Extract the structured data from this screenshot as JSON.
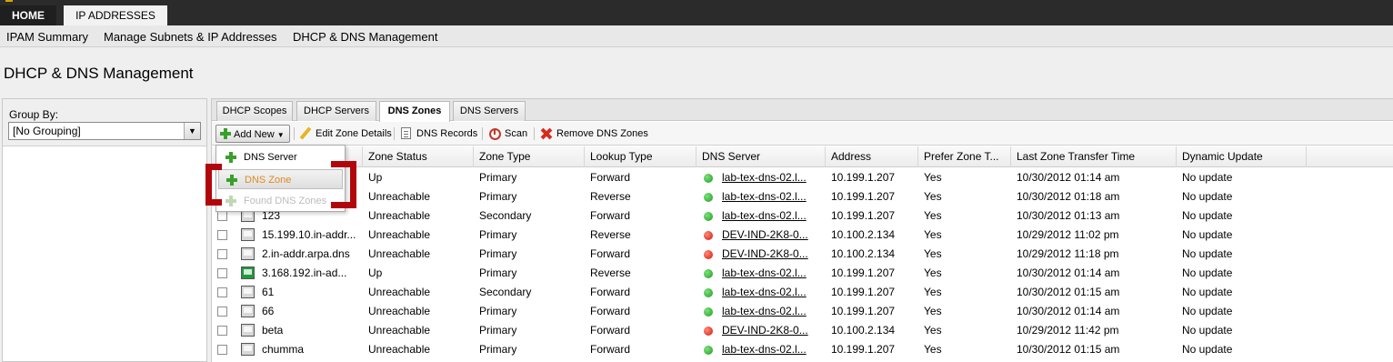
{
  "top_tabs": {
    "home": "HOME",
    "ip": "IP ADDRESSES"
  },
  "subnav": {
    "ipam": "IPAM Summary",
    "subnets": "Manage Subnets & IP Addresses",
    "dhcp_dns": "DHCP & DNS Management"
  },
  "page_title": "DHCP & DNS Management",
  "left": {
    "group_by_label": "Group By:",
    "group_by_value": "[No Grouping]"
  },
  "tabs": {
    "dhcp_scopes": "DHCP Scopes",
    "dhcp_servers": "DHCP Servers",
    "dns_zones": "DNS Zones",
    "dns_servers": "DNS Servers"
  },
  "toolbar": {
    "add_new": "Add New",
    "edit_zone": "Edit Zone Details",
    "dns_records": "DNS Records",
    "scan": "Scan",
    "remove": "Remove DNS Zones"
  },
  "menu": {
    "dns_server": "DNS Server",
    "dns_zone": "DNS Zone",
    "found_zones": "Found DNS Zones"
  },
  "columns": {
    "zone_status": "Zone Status",
    "zone_type": "Zone Type",
    "lookup_type": "Lookup Type",
    "dns_server": "DNS Server",
    "address": "Address",
    "prefer_zone": "Prefer Zone T...",
    "last_transfer": "Last Zone Transfer Time",
    "dynamic_update": "Dynamic Update"
  },
  "rows": [
    {
      "name": "",
      "icon": "up",
      "status": "Up",
      "type": "Primary",
      "lookup": "Forward",
      "server": "lab-tex-dns-02.l...",
      "server_state": "green",
      "address": "10.199.1.207",
      "prefer": "Yes",
      "last": "10/30/2012 01:14 am",
      "dyn": "No update"
    },
    {
      "name": "",
      "icon": "down",
      "status": "Unreachable",
      "type": "Primary",
      "lookup": "Reverse",
      "server": "lab-tex-dns-02.l...",
      "server_state": "green",
      "address": "10.199.1.207",
      "prefer": "Yes",
      "last": "10/30/2012 01:18 am",
      "dyn": "No update"
    },
    {
      "name": "123",
      "icon": "down",
      "status": "Unreachable",
      "type": "Secondary",
      "lookup": "Forward",
      "server": "lab-tex-dns-02.l...",
      "server_state": "green",
      "address": "10.199.1.207",
      "prefer": "Yes",
      "last": "10/30/2012 01:13 am",
      "dyn": "No update"
    },
    {
      "name": "15.199.10.in-addr...",
      "icon": "down",
      "status": "Unreachable",
      "type": "Primary",
      "lookup": "Reverse",
      "server": "DEV-IND-2K8-0...",
      "server_state": "red",
      "address": "10.100.2.134",
      "prefer": "Yes",
      "last": "10/29/2012 11:02 pm",
      "dyn": "No update"
    },
    {
      "name": "2.in-addr.arpa.dns",
      "icon": "down",
      "status": "Unreachable",
      "type": "Primary",
      "lookup": "Forward",
      "server": "DEV-IND-2K8-0...",
      "server_state": "red",
      "address": "10.100.2.134",
      "prefer": "Yes",
      "last": "10/29/2012 11:18 pm",
      "dyn": "No update"
    },
    {
      "name": "3.168.192.in-ad...",
      "icon": "up",
      "status": "Up",
      "type": "Primary",
      "lookup": "Reverse",
      "server": "lab-tex-dns-02.l...",
      "server_state": "green",
      "address": "10.199.1.207",
      "prefer": "Yes",
      "last": "10/30/2012 01:14 am",
      "dyn": "No update"
    },
    {
      "name": "61",
      "icon": "down",
      "status": "Unreachable",
      "type": "Secondary",
      "lookup": "Forward",
      "server": "lab-tex-dns-02.l...",
      "server_state": "green",
      "address": "10.199.1.207",
      "prefer": "Yes",
      "last": "10/30/2012 01:15 am",
      "dyn": "No update"
    },
    {
      "name": "66",
      "icon": "down",
      "status": "Unreachable",
      "type": "Primary",
      "lookup": "Forward",
      "server": "lab-tex-dns-02.l...",
      "server_state": "green",
      "address": "10.199.1.207",
      "prefer": "Yes",
      "last": "10/30/2012 01:14 am",
      "dyn": "No update"
    },
    {
      "name": "beta",
      "icon": "down",
      "status": "Unreachable",
      "type": "Primary",
      "lookup": "Forward",
      "server": "DEV-IND-2K8-0...",
      "server_state": "red",
      "address": "10.100.2.134",
      "prefer": "Yes",
      "last": "10/29/2012 11:42 pm",
      "dyn": "No update"
    },
    {
      "name": "chumma",
      "icon": "down",
      "status": "Unreachable",
      "type": "Primary",
      "lookup": "Forward",
      "server": "lab-tex-dns-02.l...",
      "server_state": "green",
      "address": "10.199.1.207",
      "prefer": "Yes",
      "last": "10/30/2012 01:15 am",
      "dyn": "No update"
    }
  ],
  "colors": {
    "annotation": "#b1070b",
    "up_icon": "#1e9a3c",
    "status_green": "#1d9c1d",
    "status_red": "#d4160b"
  }
}
